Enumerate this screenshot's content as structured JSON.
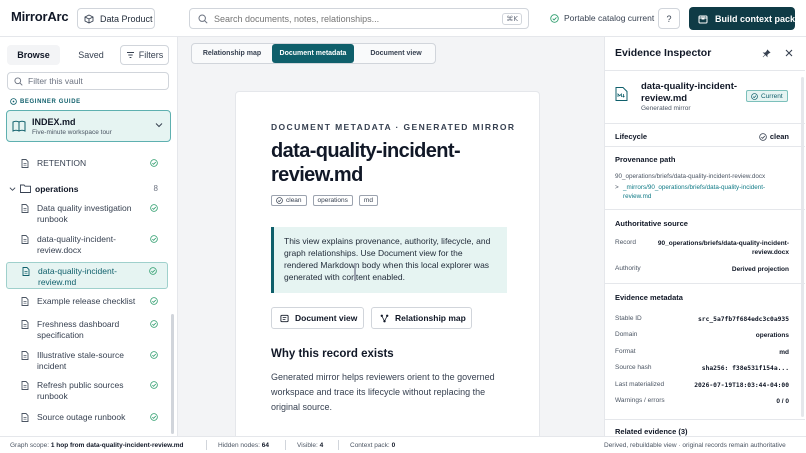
{
  "app": {
    "brand": "MirrorArc",
    "data_product_label": "Data Product",
    "search_placeholder": "Search documents, notes, relationships...",
    "search_shortcut": "⌘K",
    "portable_status": "Portable catalog current",
    "help_label": "?",
    "build_label": "Build context pack"
  },
  "sidebar": {
    "tabs": {
      "browse": "Browse",
      "saved": "Saved",
      "filters": "Filters"
    },
    "filter_placeholder": "Filter this vault",
    "guide_label": "BEGINNER GUIDE",
    "index_card": {
      "title": "INDEX.md",
      "subtitle": "Five-minute workspace tour"
    },
    "retention_label": "RETENTION",
    "folder": {
      "name": "operations",
      "count": "8"
    },
    "items": [
      {
        "label": "Data quality investigation runbook"
      },
      {
        "label": "data-quality-incident-review.docx"
      },
      {
        "label": "data-quality-incident-review.md"
      },
      {
        "label": "Example release checklist"
      },
      {
        "label": "Freshness dashboard specification"
      },
      {
        "label": "Illustrative stale-source incident"
      },
      {
        "label": "Refresh public sources runbook"
      },
      {
        "label": "Source outage runbook"
      }
    ]
  },
  "center": {
    "tabs": {
      "relationship_map": "Relationship map",
      "document_metadata": "Document metadata",
      "document_view": "Document view"
    },
    "kicker": "DOCUMENT METADATA · GENERATED MIRROR",
    "title": "data-quality-incident-review.md",
    "chips": [
      "clean",
      "operations",
      "md"
    ],
    "callout": "This view explains provenance, authority, lifecycle, and graph relationships. Use Document view for the rendered Markdown body when this local explorer was generated with content enabled.",
    "btn_document_view": "Document view",
    "btn_relationship_map": "Relationship map",
    "why_heading": "Why this record exists",
    "why_body": "Generated mirror helps reviewers orient to the governed workspace and trace its lifecycle without replacing the original source."
  },
  "inspector": {
    "title": "Evidence Inspector",
    "file_name": "data-quality-incident-review.md",
    "file_sub": "Generated mirror",
    "badge": "Current",
    "lifecycle_label": "Lifecycle",
    "lifecycle_value": "clean",
    "provenance_label": "Provenance path",
    "provenance_source": "90_operations/briefs/data-quality-incident-review.docx",
    "provenance_arrow": ">",
    "provenance_mirror": "_mirrors/90_operations/briefs/data-quality-incident-review.md",
    "authoritative_label": "Authoritative source",
    "record_key": "Record",
    "record_value": "90_operations/briefs/data-quality-incident-review.docx",
    "authority_key": "Authority",
    "authority_value": "Derived projection",
    "metadata_label": "Evidence metadata",
    "metadata": [
      {
        "k": "Stable ID",
        "v": "src_5a7fb7f684edc3c0a935"
      },
      {
        "k": "Domain",
        "v": "operations"
      },
      {
        "k": "Format",
        "v": "md"
      },
      {
        "k": "Source hash",
        "v": "sha256: f38e531f154a..."
      },
      {
        "k": "Last materialized",
        "v": "2026-07-19T18:03:44-04:00"
      },
      {
        "k": "Warnings / errors",
        "v": "0 / 0"
      }
    ],
    "related_label": "Related evidence (3)"
  },
  "status": {
    "graph_scope_label": "Graph scope:",
    "graph_scope_value": "1 hop from data-quality-incident-review.md",
    "hidden_label": "Hidden nodes:",
    "hidden_value": "64",
    "visible_label": "Visible:",
    "visible_value": "4",
    "context_label": "Context pack:",
    "context_value": "0",
    "right_note": "Derived, rebuildable view · original records remain authoritative"
  },
  "colors": {
    "accent": "#0f5f6b",
    "build_button": "#0f3b46",
    "selection_bg": "#e6f4f2",
    "check_green": "#2f9e6e"
  }
}
